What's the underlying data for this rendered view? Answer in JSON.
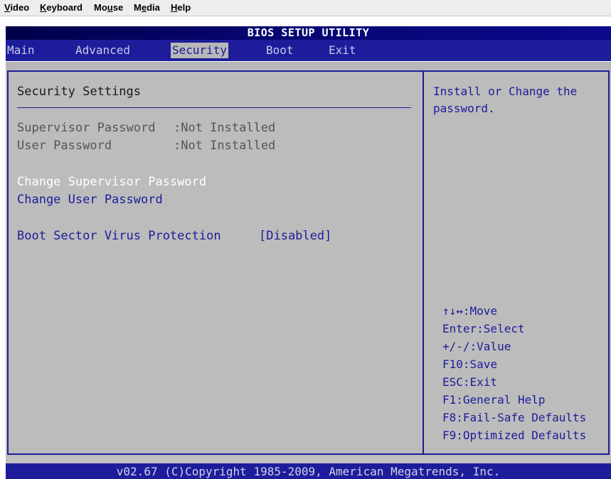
{
  "menubar": {
    "items": [
      "Video",
      "Keyboard",
      "Mouse",
      "Media",
      "Help"
    ],
    "mnemonics": [
      "V",
      "K",
      "u",
      "e",
      "H"
    ]
  },
  "bios": {
    "title": "BIOS SETUP UTILITY",
    "tabs": [
      "Main",
      "Advanced",
      "Security",
      "Boot",
      "Exit"
    ],
    "active_tab": "Security",
    "section_title": "Security Settings",
    "status": [
      {
        "label": "Supervisor Password",
        "value": ":Not Installed"
      },
      {
        "label": "User Password",
        "value": ":Not Installed"
      }
    ],
    "actions": {
      "change_supervisor": "Change Supervisor Password",
      "change_user": "Change User Password"
    },
    "option": {
      "label": "Boot Sector Virus Protection",
      "value": "[Disabled]"
    },
    "help_text": [
      "Install or Change the",
      "password."
    ],
    "keys": [
      "↑↓↔:Move",
      "Enter:Select",
      "+/-/:Value",
      "F10:Save",
      "ESC:Exit",
      "F1:General Help",
      "F8:Fail-Safe Defaults",
      "F9:Optimized Defaults"
    ],
    "footer": "v02.67 (C)Copyright 1985-2009, American Megatrends, Inc."
  },
  "colors": {
    "bios_blue": "#1c1c9a",
    "panel_gray": "#bcbcbc",
    "highlight_white": "#ffffff"
  }
}
